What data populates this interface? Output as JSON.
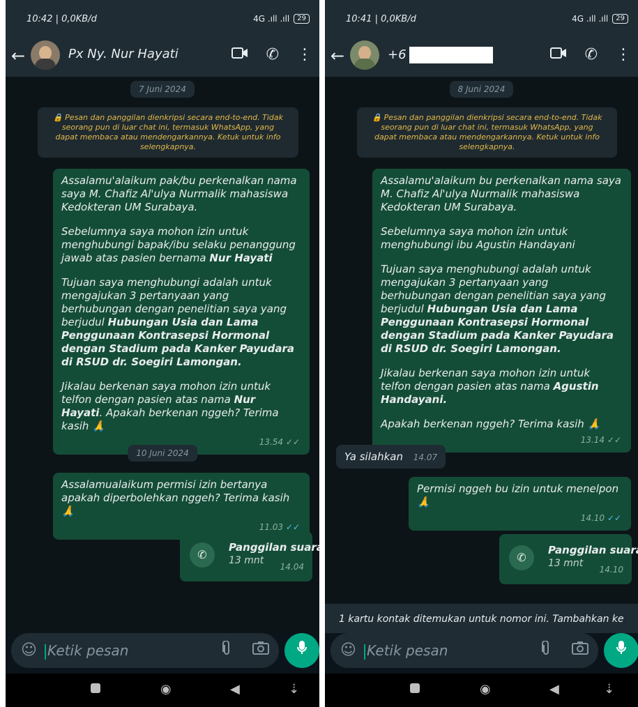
{
  "left": {
    "status_time": "10:42 | 0,0KB/d",
    "status_signal": "4G .ıll .ıll",
    "battery": "29",
    "contact_name": "Px Ny. Nur Hayati",
    "date_chip_1": "7 Juni 2024",
    "encryption_notice": "Pesan dan panggilan dienkripsi secara end-to-end. Tidak seorang pun di luar chat ini, termasuk WhatsApp, yang dapat membaca atau mendengarkannya. Ketuk untuk info selengkapnya.",
    "msg1": {
      "p1": "Assalamu'alaikum pak/bu perkenalkan nama saya M. Chafiz Al'ulya Nurmalik mahasiswa Kedokteran UM Surabaya.",
      "p2a": "Sebelumnya saya mohon izin untuk menghubungi bapak/ibu selaku penanggung jawab atas pasien bernama ",
      "p2b": "Nur Hayati",
      "p3a": "Tujuan saya menghubungi adalah untuk mengajukan 3 pertanyaan yang berhubungan dengan penelitian saya yang berjudul ",
      "p3b": "Hubungan Usia dan Lama Penggunaan Kontrasepsi Hormonal dengan Stadium pada Kanker Payudara di RSUD dr. Soegiri Lamongan.",
      "p4a": "Jikalau berkenan saya mohon izin untuk telfon dengan pasien atas nama ",
      "p4b": "Nur Hayati",
      "p4c": ". Apakah berkenan nggeh? Terima kasih 🙏",
      "time": "13.54",
      "ticks": "✓✓"
    },
    "date_chip_2": "10 Juni 2024",
    "msg2": {
      "text": "Assalamualaikum permisi izin bertanya apakah diperbolehkan nggeh? Terima kasih 🙏",
      "time": "11.03",
      "ticks": "✓✓"
    },
    "call": {
      "title": "Panggilan suara",
      "duration": "13 mnt",
      "time": "14.04"
    },
    "input_placeholder": "Ketik pesan"
  },
  "right": {
    "status_time": "10:41 | 0,0KB/d",
    "status_signal": "4G .ıll .ıll",
    "battery": "29",
    "contact_name": "+6",
    "date_chip_1": "8 Juni 2024",
    "encryption_notice": "Pesan dan panggilan dienkripsi secara end-to-end. Tidak seorang pun di luar chat ini, termasuk WhatsApp, yang dapat membaca atau mendengarkannya. Ketuk untuk info selengkapnya.",
    "msg1": {
      "p1": "Assalamu'alaikum bu perkenalkan nama saya M. Chafiz Al'ulya Nurmalik mahasiswa Kedokteran UM Surabaya.",
      "p2": "Sebelumnya saya mohon izin untuk menghubungi ibu Agustin Handayani",
      "p3a": "Tujuan saya menghubungi adalah untuk mengajukan 3 pertanyaan yang berhubungan dengan penelitian saya yang berjudul ",
      "p3b": "Hubungan Usia dan Lama Penggunaan Kontrasepsi Hormonal dengan Stadium pada Kanker Payudara di RSUD dr. Soegiri Lamongan.",
      "p4a": "Jikalau berkenan saya mohon izin untuk telfon dengan pasien atas nama ",
      "p4b": "Agustin Handayani.",
      "p5": "Apakah berkenan nggeh? Terima kasih 🙏",
      "time": "13.14",
      "ticks": "✓✓"
    },
    "incoming": {
      "text": "Ya silahkan",
      "time": "14.07"
    },
    "msg2": {
      "text": "Permisi nggeh bu izin untuk menelpon 🙏",
      "time": "14.10",
      "ticks": "✓✓"
    },
    "call": {
      "title": "Panggilan suara",
      "duration": "13 mnt",
      "time": "14.10"
    },
    "banner": "1 kartu kontak ditemukan untuk nomor ini. Tambahkan ke",
    "input_placeholder": "Ketik pesan"
  },
  "icons": {
    "back": "←",
    "video": "▭◂",
    "phone": "✆",
    "menu": "⋮",
    "emoji": "☺",
    "attach": "⌀",
    "camera": "◘",
    "mic": "🎤",
    "call_icon": "✆",
    "lock": "🔒"
  },
  "colors": {
    "accent": "#00a884",
    "outgoing_bubble": "#144d37",
    "chat_bg": "#0d1418",
    "header_bg": "#1f2c34",
    "encryption_text": "#e3b94a",
    "read_ticks": "#53bdeb"
  }
}
